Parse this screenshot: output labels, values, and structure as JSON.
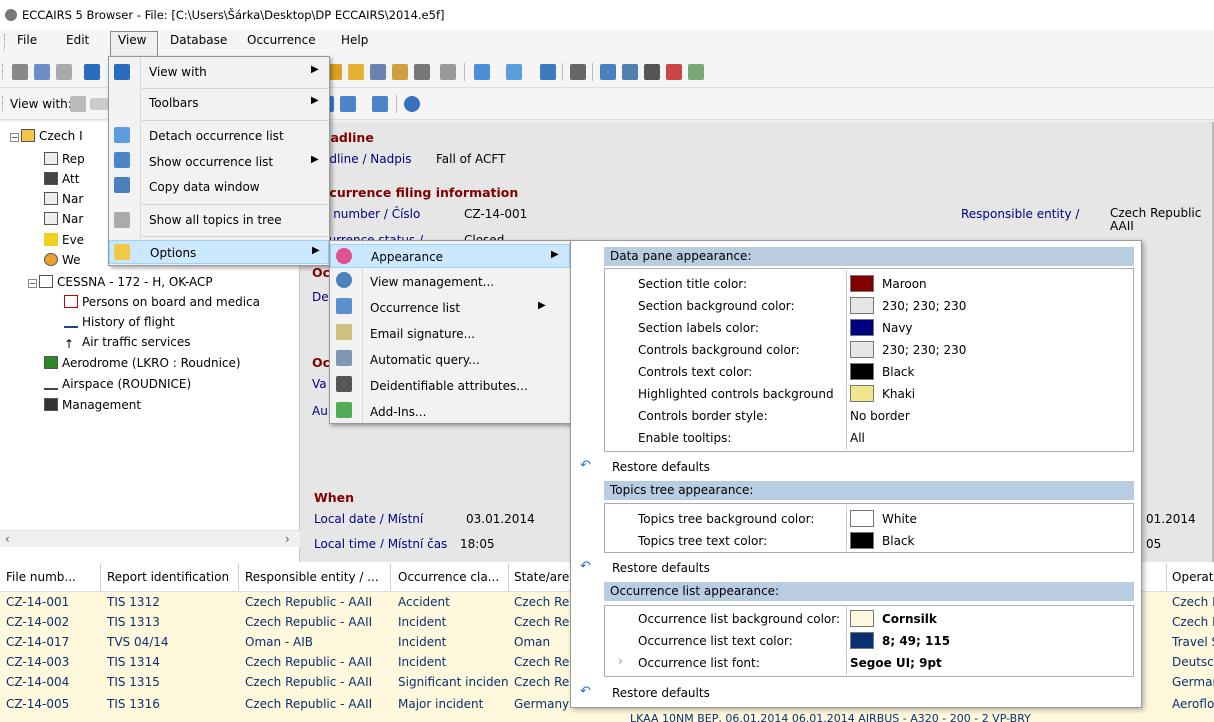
{
  "window": {
    "title": "ECCAIRS 5 Browser - File: [C:\\Users\\Šárka\\Desktop\\DP ECCAIRS\\2014.e5f]"
  },
  "menubar": [
    "File",
    "Edit",
    "View",
    "Database",
    "Occurrence",
    "Help"
  ],
  "toolbar": {
    "view_with_label": "View with:"
  },
  "view_menu": {
    "items": [
      "View with",
      "Toolbars",
      "Detach occurrence list",
      "Show occurrence list",
      "Copy data window",
      "Show all topics in tree",
      "Options"
    ]
  },
  "options_menu": {
    "items": [
      "Appearance",
      "View management...",
      "Occurrence list",
      "Email signature...",
      "Automatic query...",
      "Deidentifiable attributes...",
      "Add-Ins..."
    ]
  },
  "tree": {
    "root": "Czech I",
    "items": [
      "Rep",
      "Att",
      "Nar",
      "Nar",
      "Eve",
      "We",
      "CESSNA - 172 - H, OK-ACP",
      "Persons on board and medica",
      "History of flight",
      "Air traffic services",
      "Aerodrome (LKRO : Roudnice)",
      "Airspace (ROUDNICE)",
      "Management"
    ]
  },
  "datapane": {
    "headline_section": "eadline",
    "headline_label": "adline / Nadpis",
    "headline_value": "Fall of ACFT",
    "filing_section": "ccurrence filing information",
    "file_number_label": "e number / Číslo",
    "file_number_value": "CZ-14-001",
    "responsible_label": "Responsible entity /",
    "responsible_value": "Czech Republic AAII",
    "status_label": "currence status /",
    "status_value": "Closed",
    "partial_oc": "Oc",
    "partial_de": "De",
    "partial_oc2": "Oc",
    "partial_va": "Va",
    "partial_au": "Au",
    "when_section": "When",
    "local_date_label": "Local date / Místní",
    "local_date_value": "03.01.2014",
    "local_time_label": "Local time / Místní čas",
    "local_time_value": "18:05",
    "right_date": "01.2014",
    "right_time": "05"
  },
  "appearance": {
    "data_pane_header": "Data pane appearance:",
    "data_pane_rows": [
      {
        "label": "Section title color:",
        "value": "Maroon",
        "swatch": "#800000"
      },
      {
        "label": "Section background color:",
        "value": "230; 230; 230",
        "swatch": "#e6e6e6"
      },
      {
        "label": "Section labels color:",
        "value": "Navy",
        "swatch": "#000080"
      },
      {
        "label": "Controls background color:",
        "value": "230; 230; 230",
        "swatch": "#e6e6e6"
      },
      {
        "label": "Controls text color:",
        "value": "Black",
        "swatch": "#000000"
      },
      {
        "label": "Highlighted controls background",
        "value": "Khaki",
        "swatch": "#f0e68c"
      },
      {
        "label": "Controls border style:",
        "value": "No border"
      },
      {
        "label": "Enable tooltips:",
        "value": "All"
      }
    ],
    "restore_label": "Restore defaults",
    "topics_header": "Topics tree appearance:",
    "topics_rows": [
      {
        "label": "Topics tree background color:",
        "value": "White",
        "swatch": "#ffffff"
      },
      {
        "label": "Topics tree text color:",
        "value": "Black",
        "swatch": "#000000"
      }
    ],
    "occlist_header": "Occurrence list appearance:",
    "occlist_rows": [
      {
        "label": "Occurrence list background color:",
        "value": "Cornsilk",
        "swatch": "#fff8dc"
      },
      {
        "label": "Occurrence list text color:",
        "value": "8; 49; 115",
        "swatch": "#083173"
      },
      {
        "label": "Occurrence list font:",
        "value": "Segoe UI; 9pt"
      }
    ]
  },
  "table": {
    "headers": [
      "File numb...",
      "Report identification",
      "Responsible entity / ...",
      "Occurrence cla...",
      "State/are",
      "Operat..."
    ],
    "rows": [
      [
        "CZ-14-001",
        "TIS 1312",
        "Czech Republic - AAII",
        "Accident",
        "Czech Rep",
        "Czech Rep"
      ],
      [
        "CZ-14-002",
        "TIS 1313",
        "Czech Republic - AAII",
        "Incident",
        "Czech Rep",
        "Czech Rep"
      ],
      [
        "CZ-14-017",
        "TVS 04/14",
        "Oman - AIB",
        "Incident",
        "Oman",
        "Travel Ser"
      ],
      [
        "CZ-14-003",
        "TIS 1314",
        "Czech Republic - AAII",
        "Incident",
        "Czech Rep",
        "Deutsche"
      ],
      [
        "CZ-14-004",
        "TIS 1315",
        "Czech Republic - AAII",
        "Significant inciden",
        "Czech Rep",
        "Germany"
      ],
      [
        "CZ-14-005",
        "TIS 1316",
        "Czech Republic - AAII",
        "Major incident",
        "Germany",
        "Aeroflot -"
      ]
    ],
    "last_row_extra": "LKAA 10NM BEP, 06.01.2014   06.01.2014  AIRBUS - A320 - 200 - 2 VP-BRY"
  },
  "colors": {
    "menu_highlight": "#cce8ff",
    "section_title": "#800000",
    "section_label": "#000080",
    "list_bg": "#fff8dc",
    "list_text": "#083173"
  }
}
